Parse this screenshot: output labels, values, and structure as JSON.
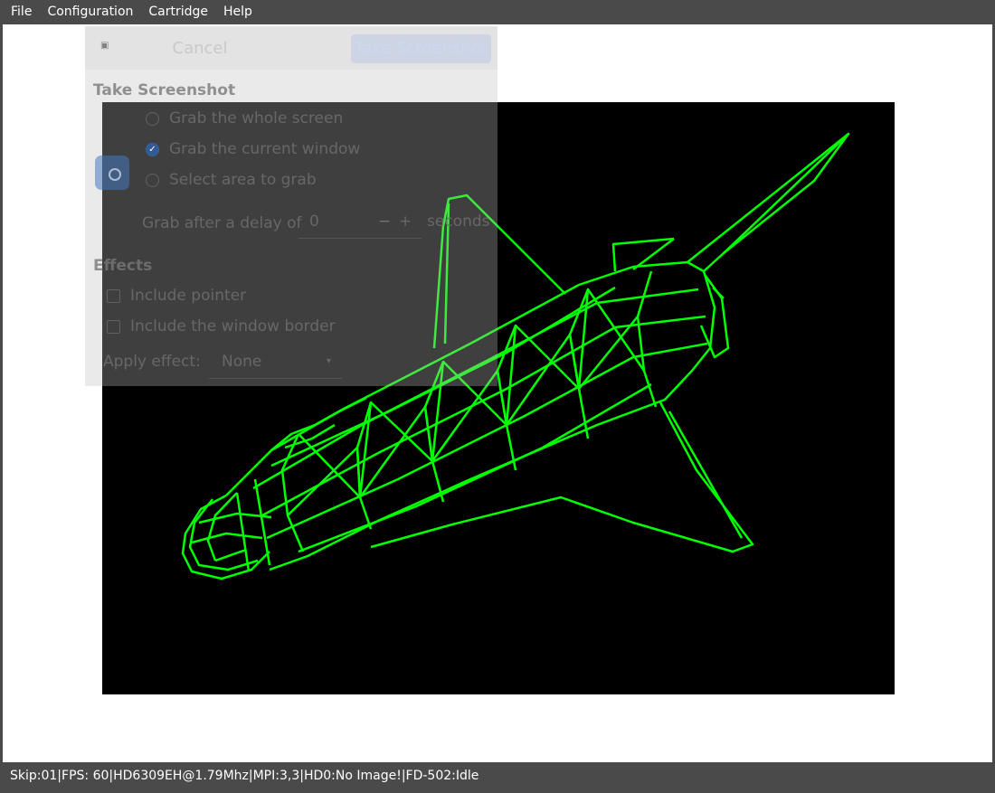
{
  "menubar": {
    "items": [
      {
        "label": "File"
      },
      {
        "label": "Configuration"
      },
      {
        "label": "Cartridge"
      },
      {
        "label": "Help"
      }
    ]
  },
  "statusbar": {
    "text": "Skip:01|FPS: 60|HD6309EH@1.79Mhz|MPI:3,3|HD0:No Image!|FD-502:Idle"
  },
  "dialog": {
    "cancel_label": "Cancel",
    "take_label": "Take Screenshot",
    "section_title": "Take Screenshot",
    "options": [
      {
        "label": "Grab the whole screen",
        "selected": false
      },
      {
        "label": "Grab the current window",
        "selected": true
      },
      {
        "label": "Select area to grab",
        "selected": false
      }
    ],
    "delay_label": "Grab after a delay of",
    "delay_value": "0",
    "delay_minus": "−",
    "delay_plus": "+",
    "delay_unit": "seconds",
    "effects_title": "Effects",
    "include_pointer": "Include pointer",
    "include_border": "Include the window border",
    "apply_effect_label": "Apply effect:",
    "apply_effect_value": "None"
  },
  "colors": {
    "wireframe": "#00ff00",
    "screen_bg": "#000000",
    "chrome": "#4a4a4a"
  }
}
